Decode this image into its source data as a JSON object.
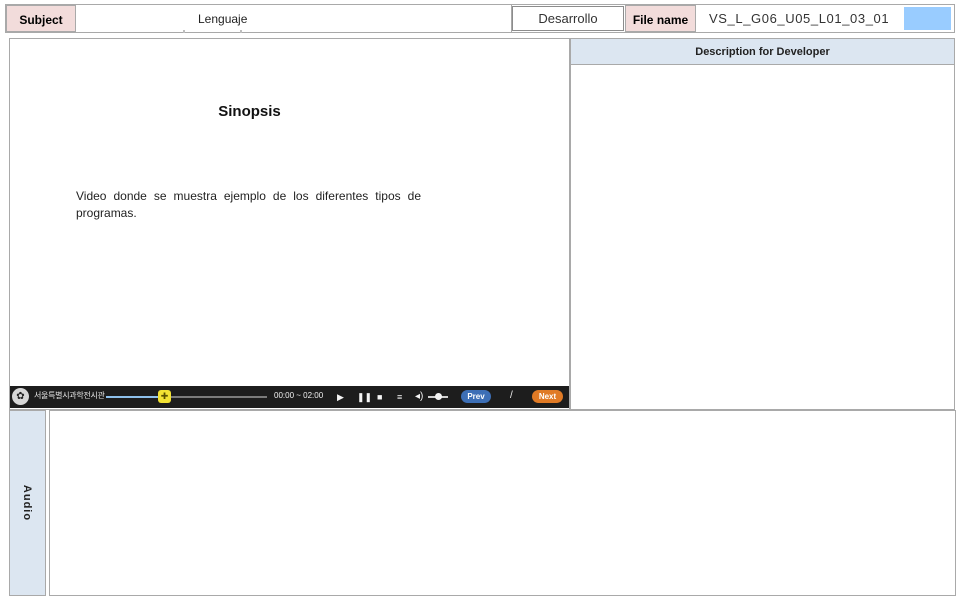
{
  "header": {
    "subject_label": "Subject",
    "subject_value": "Lenguaje",
    "stage": "Desarrollo",
    "file_label": "File name",
    "file_name": "VS_L_G06_U05_L01_03_01",
    "swatch_color": "#99ccff"
  },
  "main": {
    "title": "Sinopsis",
    "synopsis": "Video donde se muestra ejemplo de los diferentes tipos de programas."
  },
  "player": {
    "logo_icon": "emblem-icon",
    "brand": "서울특별시과학전시관",
    "progress": 0.36,
    "time": "00:00 ~ 02:00",
    "play_glyph": "▶",
    "pause_glyph": "❚❚",
    "stop_glyph": "■",
    "list_glyph": "≡",
    "volume_glyph": "◂)",
    "volume_level": 0.5,
    "prev_label": "Prev",
    "separator": "/",
    "next_label": "Next"
  },
  "developer": {
    "header": "Description for Developer"
  },
  "audio": {
    "label": "Audio"
  }
}
